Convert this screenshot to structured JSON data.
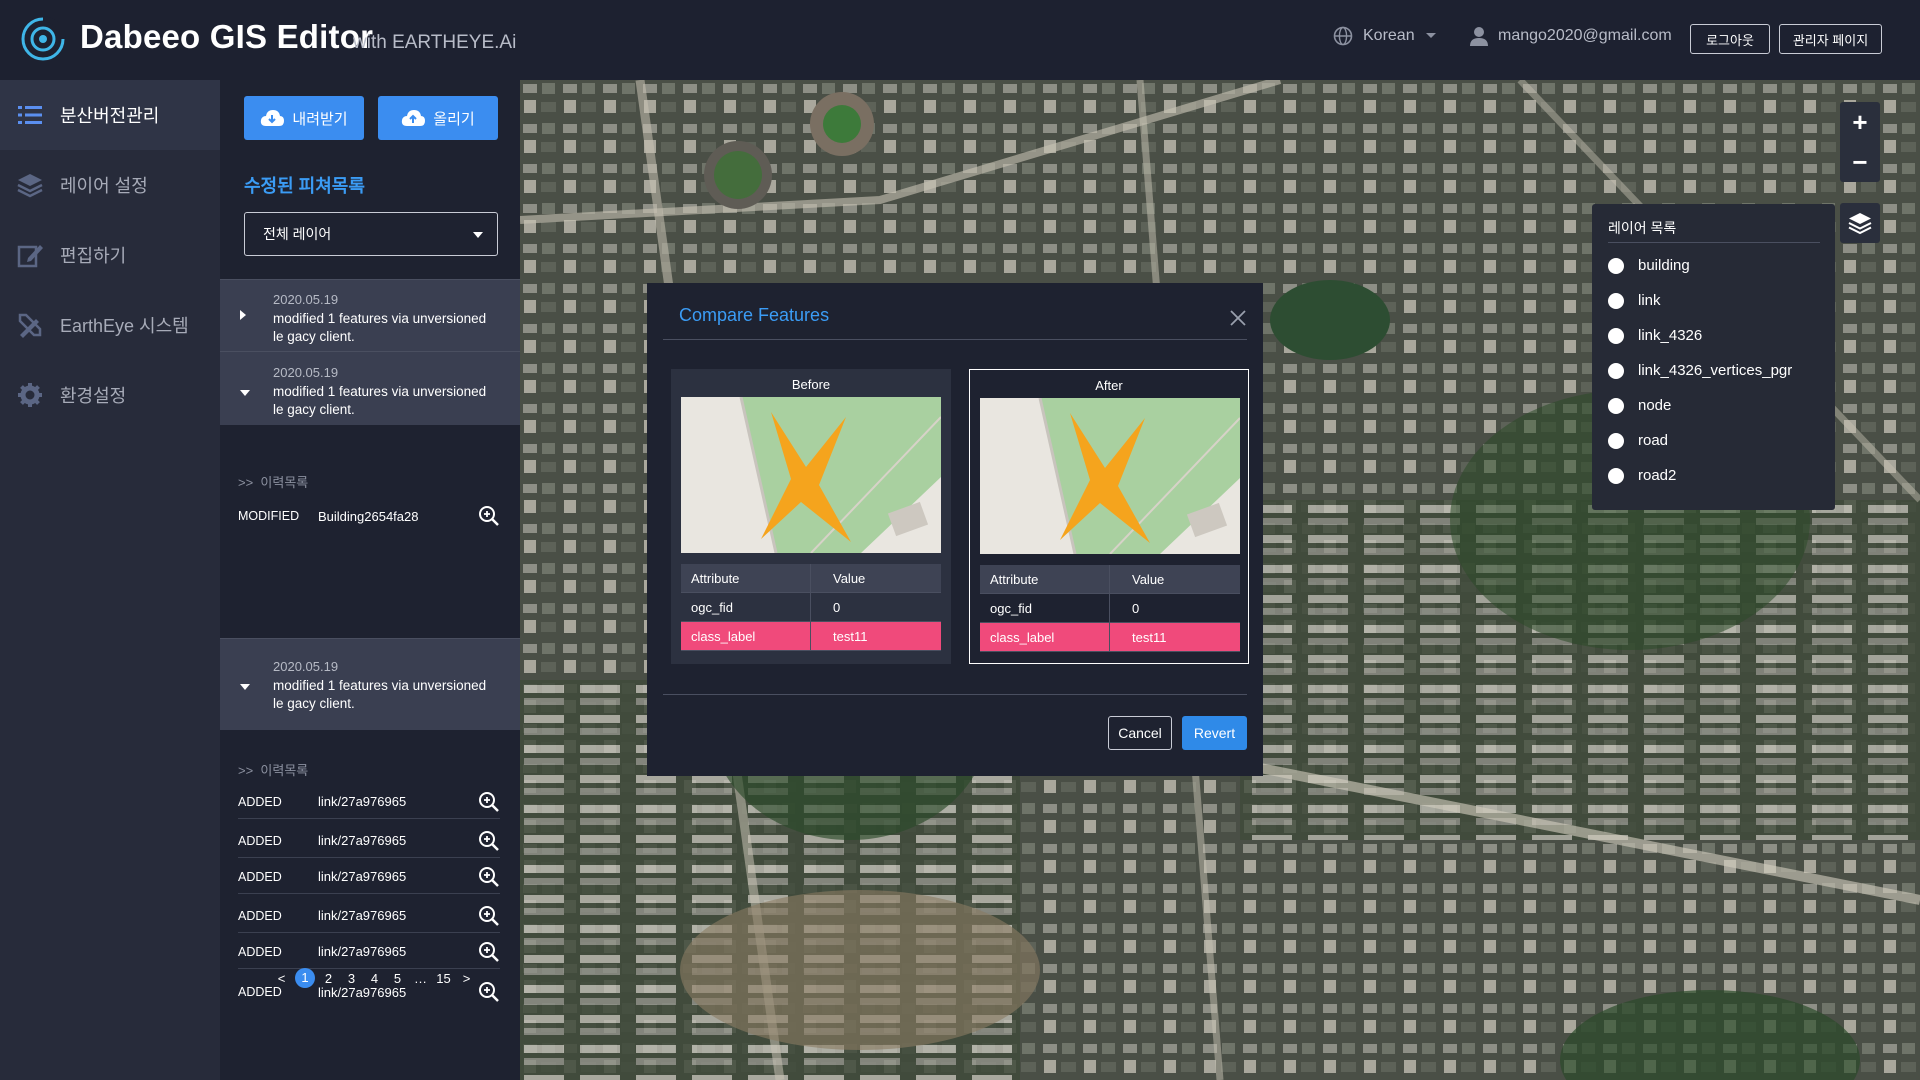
{
  "header": {
    "title": "Dabeeo GIS Editor",
    "subtitle": "with EARTHEYE.Ai",
    "language": "Korean",
    "user_email": "mango2020@gmail.com",
    "logout_label": "로그아웃",
    "admin_label": "관리자 페이지"
  },
  "nav": {
    "items": [
      {
        "label": "분산버전관리",
        "icon": "list-icon"
      },
      {
        "label": "레이어 설정",
        "icon": "layers-icon"
      },
      {
        "label": "편집하기",
        "icon": "edit-icon"
      },
      {
        "label": "EarthEye 시스템",
        "icon": "tools-icon"
      },
      {
        "label": "환경설정",
        "icon": "gear-icon"
      }
    ]
  },
  "panel": {
    "download_label": "내려받기",
    "upload_label": "올리기",
    "title": "수정된 피쳐목록",
    "layer_select": "전체 레이어",
    "groups": [
      {
        "date": "2020.05.19",
        "message": "modified 1 features via unversioned le gacy client."
      },
      {
        "date": "2020.05.19",
        "message": "modified 1 features via unversioned le gacy client."
      },
      {
        "date": "2020.05.19",
        "message": "modified 1 features via unversioned le gacy client."
      }
    ],
    "history_title": "이력목록",
    "history_prefix": ">>",
    "history1": [
      {
        "action": "MODIFIED",
        "name": "Building2654fa28"
      }
    ],
    "history2": [
      {
        "action": "ADDED",
        "name": "link/27a976965"
      },
      {
        "action": "ADDED",
        "name": "link/27a976965"
      },
      {
        "action": "ADDED",
        "name": "link/27a976965"
      },
      {
        "action": "ADDED",
        "name": "link/27a976965"
      },
      {
        "action": "ADDED",
        "name": "link/27a976965"
      },
      {
        "action": "ADDED",
        "name": "link/27a976965"
      }
    ],
    "pagination": {
      "prev": "<",
      "pages": [
        "1",
        "2",
        "3",
        "4",
        "5",
        "…",
        "15"
      ],
      "next": ">",
      "current": "1"
    }
  },
  "map": {
    "zoom_in": "+",
    "zoom_out": "−",
    "layer_list_title": "레이어 목록",
    "layers": [
      "building",
      "link",
      "link_4326",
      "link_4326_vertices_pgr",
      "node",
      "road",
      "road2"
    ]
  },
  "modal": {
    "title": "Compare Features",
    "before_label": "Before",
    "after_label": "After",
    "attr_header": "Attribute",
    "value_header": "Value",
    "rows": [
      {
        "attribute": "ogc_fid",
        "value": "0",
        "highlight": false
      },
      {
        "attribute": "class_label",
        "value": "test11",
        "highlight": true
      }
    ],
    "cancel_label": "Cancel",
    "revert_label": "Revert",
    "highlight_color": "#f04a7b",
    "accent_color": "#3b9cf5"
  }
}
